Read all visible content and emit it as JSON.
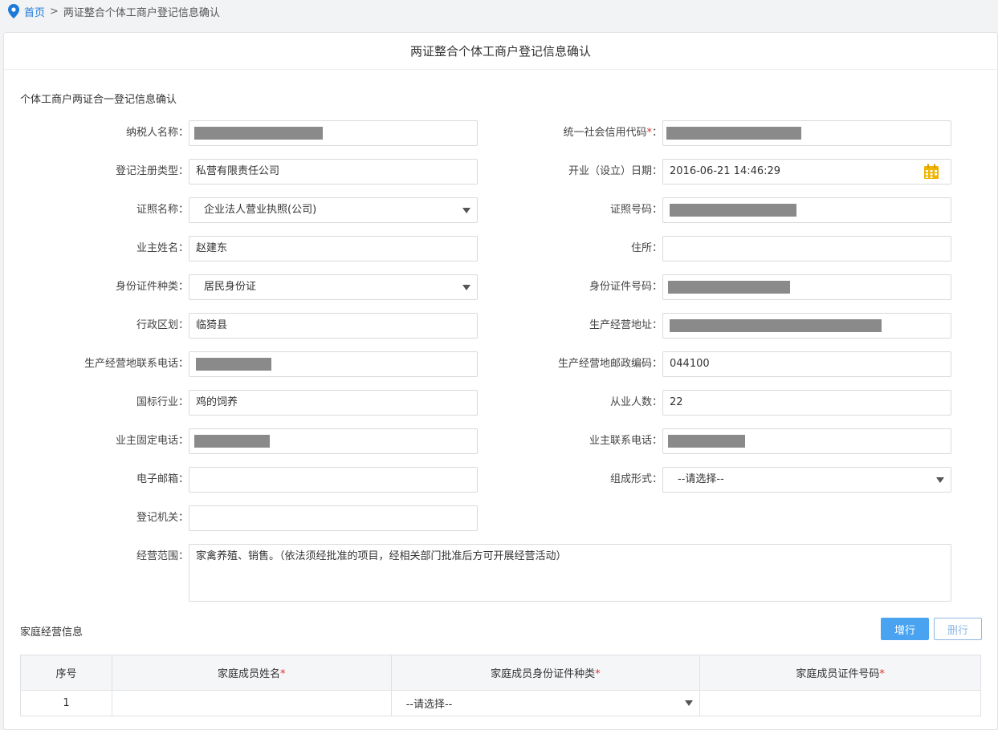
{
  "breadcrumb": {
    "home": "首页",
    "separator": ">",
    "current": "两证整合个体工商户登记信息确认"
  },
  "panel": {
    "title": "两证整合个体工商户登记信息确认",
    "subtitle": "个体工商户两证合一登记信息确认"
  },
  "form": {
    "taxpayer_name": {
      "label": "纳税人名称："
    },
    "credit_code": {
      "label": "统一社会信用代码",
      "required_mark": "*",
      "colon": "："
    },
    "reg_type": {
      "label": "登记注册类型：",
      "value": "私营有限责任公司"
    },
    "open_date": {
      "label": "开业（设立）日期：",
      "value": "2016-06-21 14:46:29"
    },
    "license_name": {
      "label": "证照名称：",
      "value": "企业法人营业执照(公司)"
    },
    "license_no": {
      "label": "证照号码："
    },
    "owner_name": {
      "label": "业主姓名：",
      "value": "赵建东"
    },
    "residence": {
      "label": "住所：",
      "value": ""
    },
    "id_type": {
      "label": "身份证件种类：",
      "value": "居民身份证"
    },
    "id_no": {
      "label": "身份证件号码："
    },
    "district": {
      "label": "行政区划：",
      "value": "临猗县"
    },
    "biz_address": {
      "label": "生产经营地址："
    },
    "biz_phone": {
      "label": "生产经营地联系电话："
    },
    "biz_postcode": {
      "label": "生产经营地邮政编码：",
      "value": "044100"
    },
    "industry": {
      "label": "国标行业：",
      "value": "鸡的饲养"
    },
    "employees": {
      "label": "从业人数：",
      "value": "22"
    },
    "owner_landline": {
      "label": "业主固定电话："
    },
    "owner_mobile": {
      "label": "业主联系电话："
    },
    "email": {
      "label": "电子邮箱：",
      "value": ""
    },
    "org_form": {
      "label": "组成形式：",
      "value": "--请选择--"
    },
    "reg_authority": {
      "label": "登记机关：",
      "value": ""
    },
    "scope": {
      "label": "经营范围：",
      "value": "家禽养殖、销售。（依法须经批准的项目，经相关部门批准后方可开展经营活动）"
    }
  },
  "family": {
    "section_title": "家庭经营信息",
    "add_button": "增行",
    "delete_button": "删行",
    "columns": [
      "序号",
      "家庭成员姓名",
      "家庭成员身份证件种类",
      "家庭成员证件号码"
    ],
    "required_mark": "*",
    "rows": [
      {
        "index": "1",
        "name": "",
        "id_type": "--请选择--",
        "id_no": ""
      }
    ]
  },
  "colors": {
    "accent": "#4aa3f0",
    "link": "#1e7ad8",
    "required": "#e03030",
    "calendar_icon": "#f0b400",
    "redaction": "#8a8a8a"
  }
}
